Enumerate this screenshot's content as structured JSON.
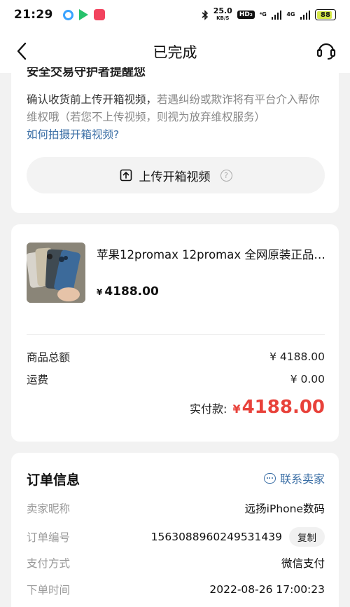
{
  "status_bar": {
    "time": "21:29",
    "speed_value": "25.0",
    "speed_unit": "KB/S",
    "hd_badge": "HD₂",
    "net_1": "⁴G",
    "net_2": "4G",
    "battery": "88",
    "icons": [
      "app-circle-icon",
      "play-icon",
      "app-red-icon",
      "bluetooth-icon",
      "signal-icon",
      "battery-icon"
    ]
  },
  "nav": {
    "title": "已完成",
    "icons": [
      "back-icon",
      "customer-service-icon"
    ]
  },
  "security_card": {
    "cut_title": "安全交易守护者提醒您",
    "desc_main": "确认收货前上传开箱视频，",
    "desc_muted": "若遇纠纷或欺诈将有平台介入帮你维权哦（若您不上传视频，则视为放弃维权服务）",
    "link": "如何拍摄开箱视频?",
    "upload_label": "上传开箱视频",
    "help_mark": "?"
  },
  "product": {
    "title": "苹果12promax 12promax 全网原装正品 ...",
    "price_symbol": "¥",
    "price": "4188.00"
  },
  "summary": {
    "goods_total_label": "商品总额",
    "goods_total_value": "¥ 4188.00",
    "shipping_label": "运费",
    "shipping_value": "¥ 0.00",
    "paid_label": "实付款:",
    "paid_symbol": "¥",
    "paid_value": "4188.00"
  },
  "order_info": {
    "title": "订单信息",
    "contact_label": "联系卖家",
    "copy_label": "复制",
    "rows": [
      {
        "key": "卖家昵称",
        "value": "远扬iPhone数码"
      },
      {
        "key": "订单编号",
        "value": "1563088960249531439"
      },
      {
        "key": "支付方式",
        "value": "微信支付"
      },
      {
        "key": "下单时间",
        "value": "2022-08-26 17:00:23"
      }
    ]
  },
  "colors": {
    "accent_link": "#3a6ea5",
    "price_red": "#e8413a",
    "background": "#f2f2f2"
  }
}
